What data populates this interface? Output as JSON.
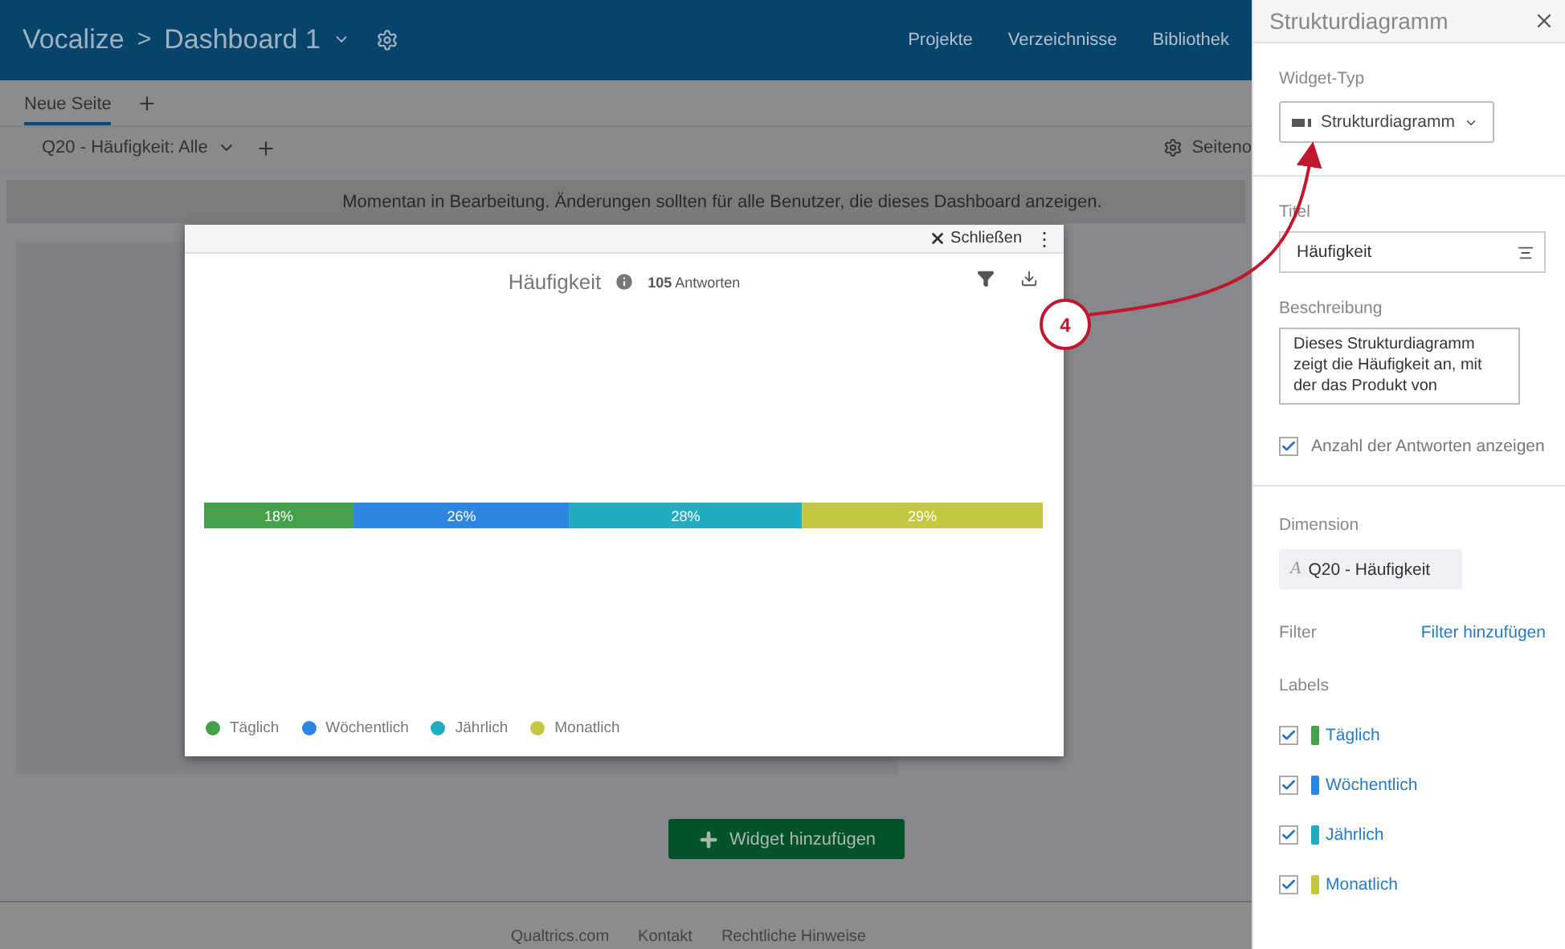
{
  "header": {
    "brand": "Vocalize",
    "separator": ">",
    "dashboard": "Dashboard 1",
    "nav": [
      "Projekte",
      "Verzeichnisse",
      "Bibliothek"
    ]
  },
  "page_tabs": [
    {
      "label": "Neue Seite",
      "selected": true
    }
  ],
  "filter_bar": {
    "filter": "Q20 - Häufigkeit: Alle",
    "page_options": "Seiteno"
  },
  "banner": "Momentan in Bearbeitung. Änderungen sollten für alle Benutzer, die dieses Dashboard anzeigen.",
  "add_widget": "Widget hinzufügen",
  "footer": [
    "Qualtrics.com",
    "Kontakt",
    "Rechtliche Hinweise"
  ],
  "widget": {
    "close": "Schließen",
    "more": "⋮",
    "title": "Häufigkeit",
    "responses": "**105** Antworten",
    "chart_data": {
      "type": "bar",
      "orientation": "horizontal",
      "stacked": true,
      "series": [
        {
          "name": "Täglich",
          "color": "#45a04a",
          "values": [
            18
          ],
          "value_labels": [
            "18%"
          ]
        },
        {
          "name": "Wöchentlich",
          "color": "#2d87e2",
          "values": [
            26
          ],
          "value_labels": [
            "26%"
          ]
        },
        {
          "name": "Jährlich",
          "color": "#21adbf",
          "values": [
            28
          ],
          "value_labels": [
            "28%"
          ]
        },
        {
          "name": "Monatlich",
          "color": "#c3c83f",
          "values": [
            29
          ],
          "value_labels": [
            "29%"
          ]
        }
      ]
    }
  },
  "callout": {
    "number": "4"
  },
  "panel": {
    "title": "Strukturdiagramm",
    "widget_type_label": "Widget-Typ",
    "widget_type": "Strukturdiagramm",
    "title_label": "Titel",
    "title_value": "Häufigkeit",
    "description_label": "Beschreibung",
    "description": "Dieses Strukturdiagramm zeigt die Häufigkeit an, mit der das Produkt von",
    "show_count": {
      "label": "Anzahl der Antworten anzeigen",
      "checked": true
    },
    "dimension_label": "Dimension",
    "dimension_icon": "A",
    "dimension": "Q20 - Häufigkeit",
    "filter_label": "Filter",
    "filter_link": "Filter hinzufügen",
    "labels_label": "Labels",
    "labels": [
      {
        "name": "Täglich",
        "color": "#45a04a",
        "checked": true
      },
      {
        "name": "Wöchentlich",
        "color": "#2d87e2",
        "checked": true
      },
      {
        "name": "Jährlich",
        "color": "#21adbf",
        "checked": true
      },
      {
        "name": "Monatlich",
        "color": "#c3c83f",
        "checked": true
      }
    ]
  }
}
